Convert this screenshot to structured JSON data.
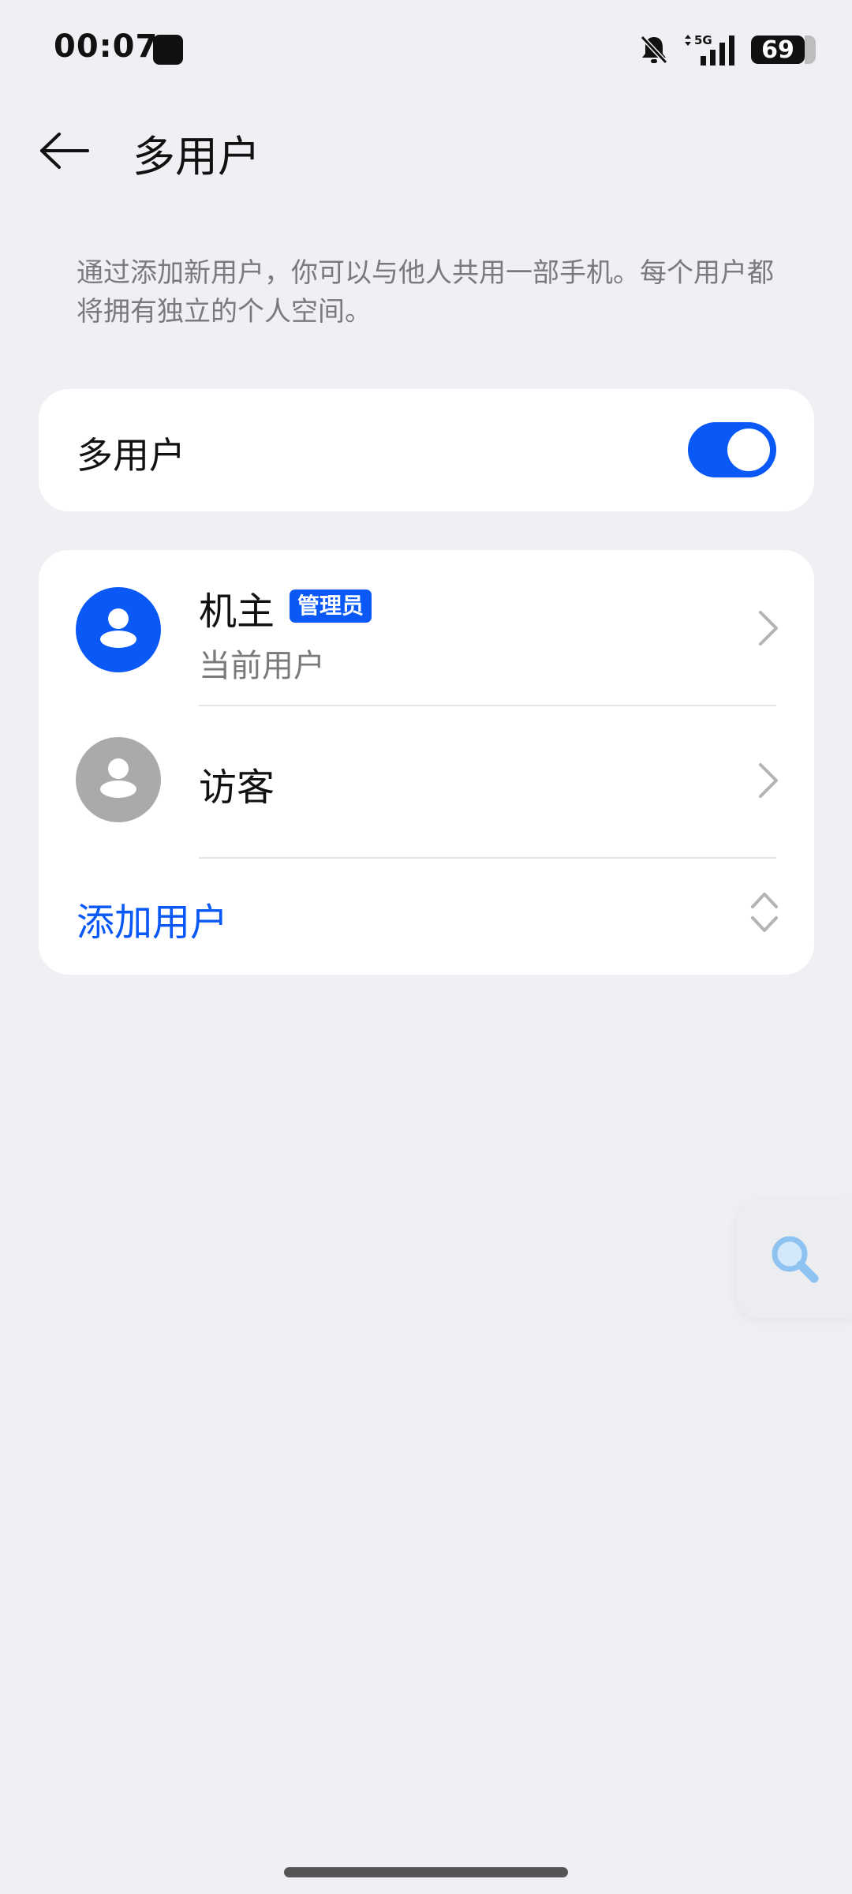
{
  "status_bar": {
    "time": "00:07",
    "network": "5G",
    "battery": "69"
  },
  "header": {
    "title": "多用户"
  },
  "description": "通过添加新用户，你可以与他人共用一部手机。每个用户都将拥有独立的个人空间。",
  "multi_user": {
    "label": "多用户",
    "enabled": true
  },
  "users": [
    {
      "name": "机主",
      "badge": "管理员",
      "subtitle": "当前用户"
    },
    {
      "name": "访客"
    }
  ],
  "add_user_label": "添加用户",
  "colors": {
    "accent": "#0a59f7",
    "guest_avatar": "#aaaaaa",
    "background": "#eff0f3"
  },
  "icons": {
    "back": "arrow-left-icon",
    "status_app": "app-notification-icon",
    "mute": "bell-muted-icon",
    "signal": "signal-bars-icon",
    "avatar": "person-icon",
    "chevron": "chevron-right-icon",
    "expand": "chevron-up-down-icon",
    "search": "search-icon"
  }
}
